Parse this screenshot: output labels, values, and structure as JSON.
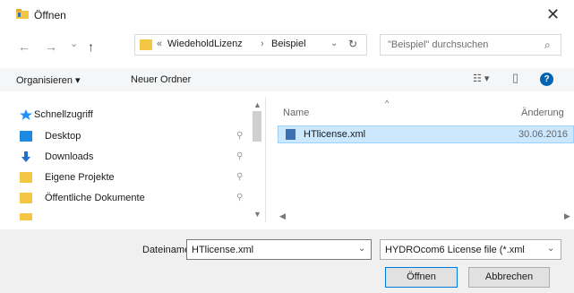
{
  "title": "Öffnen",
  "close_glyph": "✕",
  "nav": {
    "back": "←",
    "forward": "→",
    "recent": "⌄",
    "up": "↑"
  },
  "address": {
    "prefix": "«",
    "crumbs": [
      "WiedeholdLizenz",
      "Beispiel"
    ],
    "separator": "›",
    "dropdown": "⌄",
    "refresh": "↻"
  },
  "search": {
    "placeholder": "\"Beispiel\" durchsuchen",
    "icon": "⌕"
  },
  "toolbar": {
    "organize": "Organisieren ▾",
    "new_folder": "Neuer Ordner",
    "view_glyph": "☷ ▾",
    "preview_glyph": "▯",
    "help_glyph": "?"
  },
  "sidebar": {
    "items": [
      {
        "label": "Schnellzugriff",
        "icon": "star-icon",
        "color": "#1e90ff"
      },
      {
        "label": "Desktop",
        "icon": "desktop-icon",
        "color": "#1e88e5"
      },
      {
        "label": "Downloads",
        "icon": "download-icon",
        "color": "#1e6fd0"
      },
      {
        "label": "Eigene Projekte",
        "icon": "folder-icon",
        "color": "#f3c743"
      },
      {
        "label": "Öffentliche Dokumente",
        "icon": "folder-icon",
        "color": "#f3c743"
      }
    ],
    "pin_glyph": "⚲"
  },
  "columns": {
    "name": "Name",
    "changed": "Änderung"
  },
  "files": [
    {
      "name": "HTlicense.xml",
      "date": "30.06.2016"
    }
  ],
  "bottom": {
    "filename_label": "Dateiname:",
    "filename_value": "HTlicense.xml",
    "filetype_value": "HYDROcom6 License file (*.xml",
    "open_button": "Öffnen",
    "cancel_button": "Abbrechen"
  },
  "colors": {
    "selection_bg": "#cce8ff",
    "accent": "#0078d7"
  }
}
